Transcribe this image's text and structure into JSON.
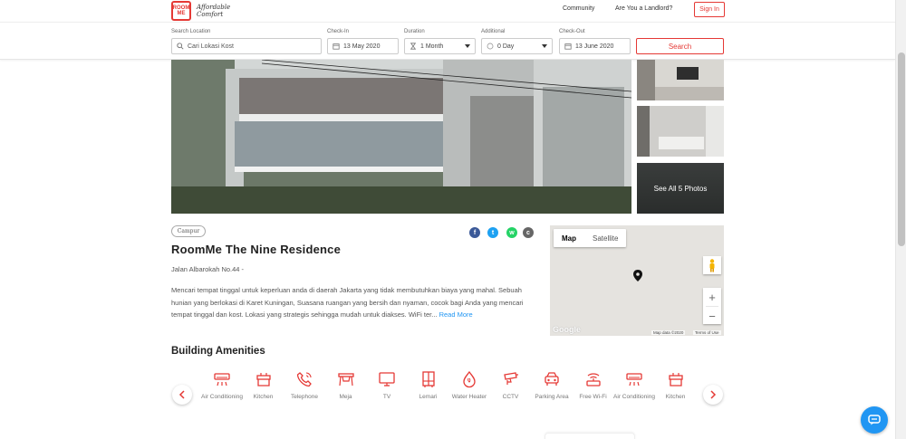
{
  "header": {
    "logo_text": "ROOM ME",
    "logo_tagline_1": "Affordable",
    "logo_tagline_2": "Comfort",
    "nav": {
      "community": "Community",
      "landlord": "Are You a Landlord?"
    },
    "signin_label": "Sign In"
  },
  "search": {
    "location_label": "Search Location",
    "location_placeholder": "Cari Lokasi Kost",
    "checkin_label": "Check-In",
    "checkin_value": "13 May 2020",
    "duration_label": "Duration",
    "duration_value": "1 Month",
    "additional_label": "Additional",
    "additional_value": "0 Day",
    "checkout_label": "Check-Out",
    "checkout_value": "13 June 2020",
    "search_button": "Search"
  },
  "gallery": {
    "see_all": "See All 5 Photos"
  },
  "property": {
    "tag": "Campur",
    "name": "RoomMe The Nine Residence",
    "address": "Jalan Albarokah No.44 -",
    "description": "Mencari tempat tinggal untuk keperluan anda di daerah Jakarta yang tidak membutuhkan biaya yang mahal. Sebuah hunian yang berlokasi di Karet Kuningan, Suasana ruangan yang bersih dan nyaman, cocok bagi Anda yang mencari tempat tinggal dan kost. Lokasi yang strategis sehingga mudah untuk diakses. WiFi ter...",
    "read_more": "Read More"
  },
  "share": {
    "facebook": "f",
    "twitter": "t",
    "whatsapp": "w",
    "copy": "c"
  },
  "map": {
    "tab_map": "Map",
    "tab_satellite": "Satellite",
    "google": "Google",
    "data_credit": "Map data ©2020",
    "terms": "Terms of Use"
  },
  "amenities": {
    "heading": "Building Amenities",
    "items": [
      {
        "label": "Air Conditioning",
        "icon": "ac-icon"
      },
      {
        "label": "Kitchen",
        "icon": "kitchen-icon"
      },
      {
        "label": "Telephone",
        "icon": "telephone-icon"
      },
      {
        "label": "Meja",
        "icon": "table-icon"
      },
      {
        "label": "TV",
        "icon": "tv-icon"
      },
      {
        "label": "Lemari",
        "icon": "wardrobe-icon"
      },
      {
        "label": "Water Heater",
        "icon": "water-heater-icon"
      },
      {
        "label": "CCTV",
        "icon": "cctv-icon"
      },
      {
        "label": "Parking Area",
        "icon": "parking-icon"
      },
      {
        "label": "Free Wi-Fi",
        "icon": "wifi-icon"
      },
      {
        "label": "Air Conditioning",
        "icon": "ac-icon"
      },
      {
        "label": "Kitchen",
        "icon": "kitchen-icon"
      }
    ]
  },
  "colors": {
    "accent": "#e53935",
    "link": "#2196f3",
    "facebook": "#3b5998",
    "twitter": "#1da1f2",
    "whatsapp": "#25d366",
    "copy": "#666666"
  }
}
